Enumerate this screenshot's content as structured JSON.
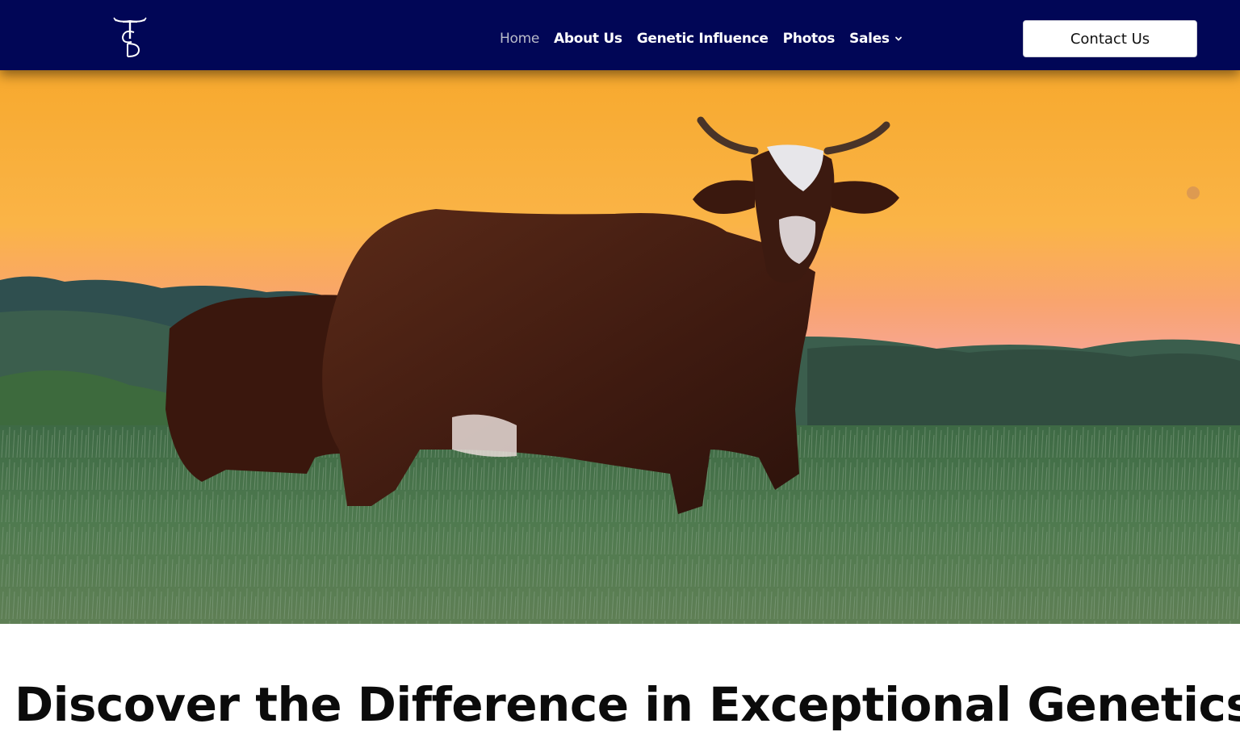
{
  "header": {
    "logo": {
      "letters": "TCD",
      "icon": "steer-horns-monogram-icon"
    },
    "nav": [
      {
        "label": "Home",
        "active": true
      },
      {
        "label": "About Us",
        "active": false
      },
      {
        "label": "Genetic Influence",
        "active": false
      },
      {
        "label": "Photos",
        "active": false
      },
      {
        "label": "Sales",
        "active": false,
        "has_dropdown": true
      }
    ],
    "contact_button": "Contact Us",
    "colors": {
      "background": "#010656",
      "active_link": "#b9bbc9",
      "link": "#ffffff"
    }
  },
  "hero": {
    "image": "hero-cattle-sunset-photo"
  },
  "main": {
    "headline": "Discover the Difference in Exceptional Genetics"
  }
}
